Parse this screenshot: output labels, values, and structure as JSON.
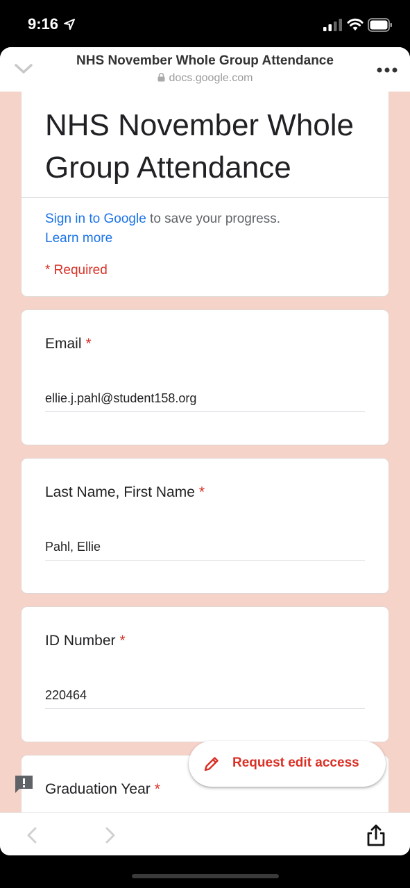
{
  "status_bar": {
    "time": "9:16"
  },
  "header": {
    "title": "NHS November Whole Group Attendance",
    "domain": "docs.google.com"
  },
  "form": {
    "title": "NHS November Whole Group Attendance",
    "signin_link": "Sign in to Google",
    "signin_rest": " to save your progress.",
    "learn_more": "Learn more",
    "required_note": "* Required",
    "questions": [
      {
        "label": "Email",
        "required": "*",
        "value": "ellie.j.pahl@student158.org"
      },
      {
        "label": "Last Name, First Name",
        "required": "*",
        "value": "Pahl, Ellie"
      },
      {
        "label": "ID Number",
        "required": "*",
        "value": "220464"
      },
      {
        "label": "Graduation Year",
        "required": "*"
      }
    ]
  },
  "fab": {
    "label": "Request edit access"
  },
  "colors": {
    "accent_red": "#d93025",
    "link_blue": "#1a73e8",
    "page_bg": "#f6d3c9"
  },
  "icons": [
    "location-arrow-icon",
    "signal-icon",
    "wifi-icon",
    "battery-icon",
    "chevron-down-icon",
    "lock-icon",
    "more-icon",
    "pencil-icon",
    "feedback-icon",
    "back-arrow-icon",
    "forward-arrow-icon",
    "share-icon"
  ]
}
